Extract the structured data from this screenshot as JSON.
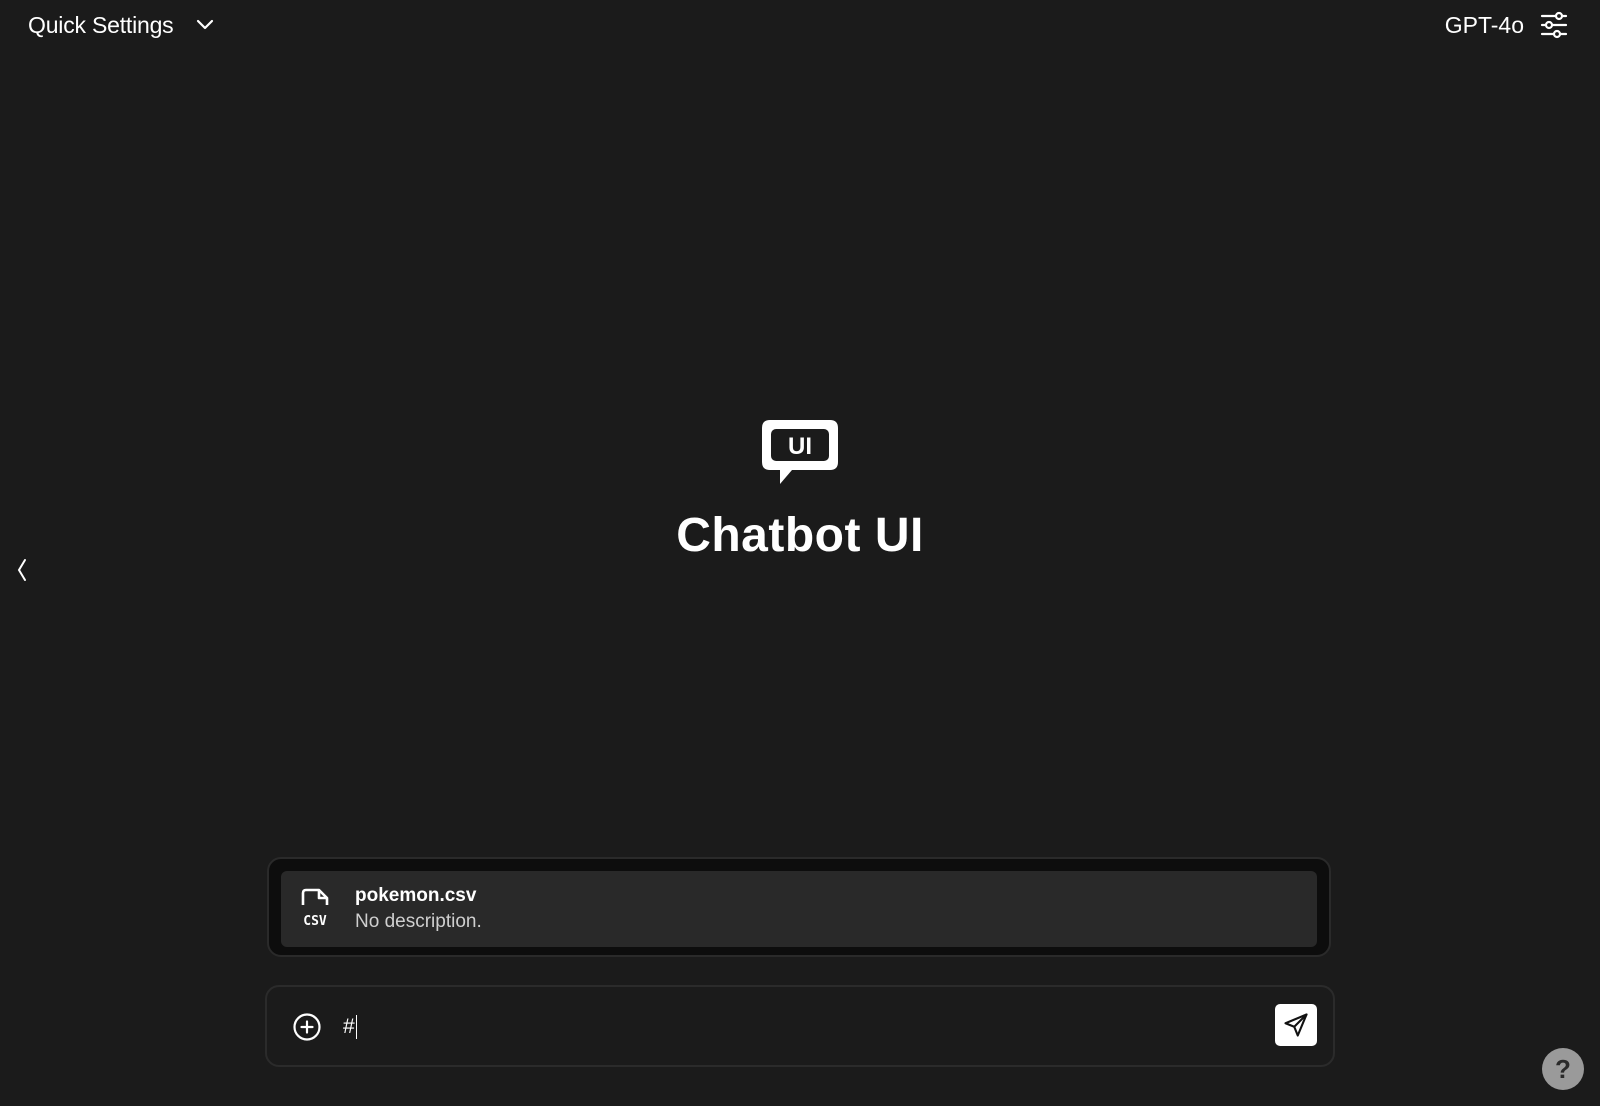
{
  "header": {
    "quick_settings_label": "Quick Settings",
    "model_name": "GPT-4o"
  },
  "brand": {
    "logo_text": "UI",
    "title": "Chatbot UI"
  },
  "file_picker": {
    "items": [
      {
        "icon": "csv-file-icon",
        "icon_text": "CSV",
        "name": "pokemon.csv",
        "description": "No description."
      }
    ]
  },
  "chat_input": {
    "value": "#"
  },
  "help": {
    "label": "?"
  },
  "colors": {
    "background": "#1b1b1b",
    "picker_bg": "#0d0d0d",
    "file_item_bg": "#292929",
    "text": "#ffffff",
    "muted_text": "#cfcfcf",
    "help_bg": "#9a9a9a"
  }
}
